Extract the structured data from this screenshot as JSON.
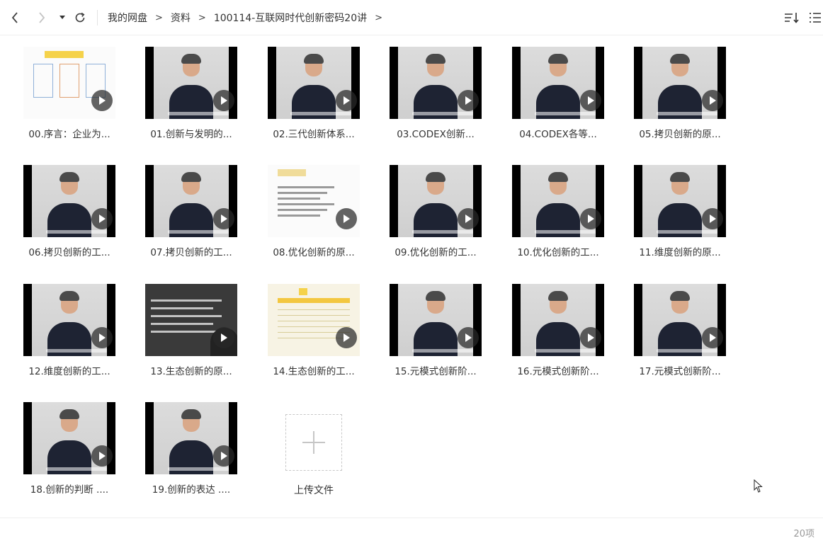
{
  "breadcrumb": {
    "items": [
      "我的网盘",
      "资料",
      "100114-互联网时代创新密码20讲"
    ],
    "separator": ">"
  },
  "files": [
    {
      "name": "00.序言：企业为...",
      "thumb": "slide"
    },
    {
      "name": "01.创新与发明的...",
      "thumb": "person"
    },
    {
      "name": "02.三代创新体系...",
      "thumb": "person"
    },
    {
      "name": "03.CODEX创新...",
      "thumb": "person"
    },
    {
      "name": "04.CODEX各等...",
      "thumb": "person"
    },
    {
      "name": "05.拷贝创新的原...",
      "thumb": "person"
    },
    {
      "name": "06.拷贝创新的工...",
      "thumb": "person"
    },
    {
      "name": "07.拷贝创新的工...",
      "thumb": "person"
    },
    {
      "name": "08.优化创新的原...",
      "thumb": "slide2"
    },
    {
      "name": "09.优化创新的工...",
      "thumb": "person"
    },
    {
      "name": "10.优化创新的工...",
      "thumb": "person"
    },
    {
      "name": "11.维度创新的原...",
      "thumb": "person"
    },
    {
      "name": "12.维度创新的工...",
      "thumb": "person"
    },
    {
      "name": "13.生态创新的原...",
      "thumb": "dark"
    },
    {
      "name": "14.生态创新的工...",
      "thumb": "table"
    },
    {
      "name": "15.元模式创新阶...",
      "thumb": "person"
    },
    {
      "name": "16.元模式创新阶...",
      "thumb": "person"
    },
    {
      "name": "17.元模式创新阶...",
      "thumb": "person"
    },
    {
      "name": "18.创新的判断 ....",
      "thumb": "person"
    },
    {
      "name": "19.创新的表达 ....",
      "thumb": "person"
    }
  ],
  "upload": {
    "label": "上传文件"
  },
  "status": {
    "count": "20项"
  },
  "icons": {
    "back": "chevron-left-icon",
    "forward": "chevron-right-icon",
    "history": "dropdown-triangle-icon",
    "refresh": "refresh-icon",
    "sort": "sort-icon",
    "view": "list-view-icon",
    "play": "play-icon",
    "upload": "plus-icon"
  }
}
